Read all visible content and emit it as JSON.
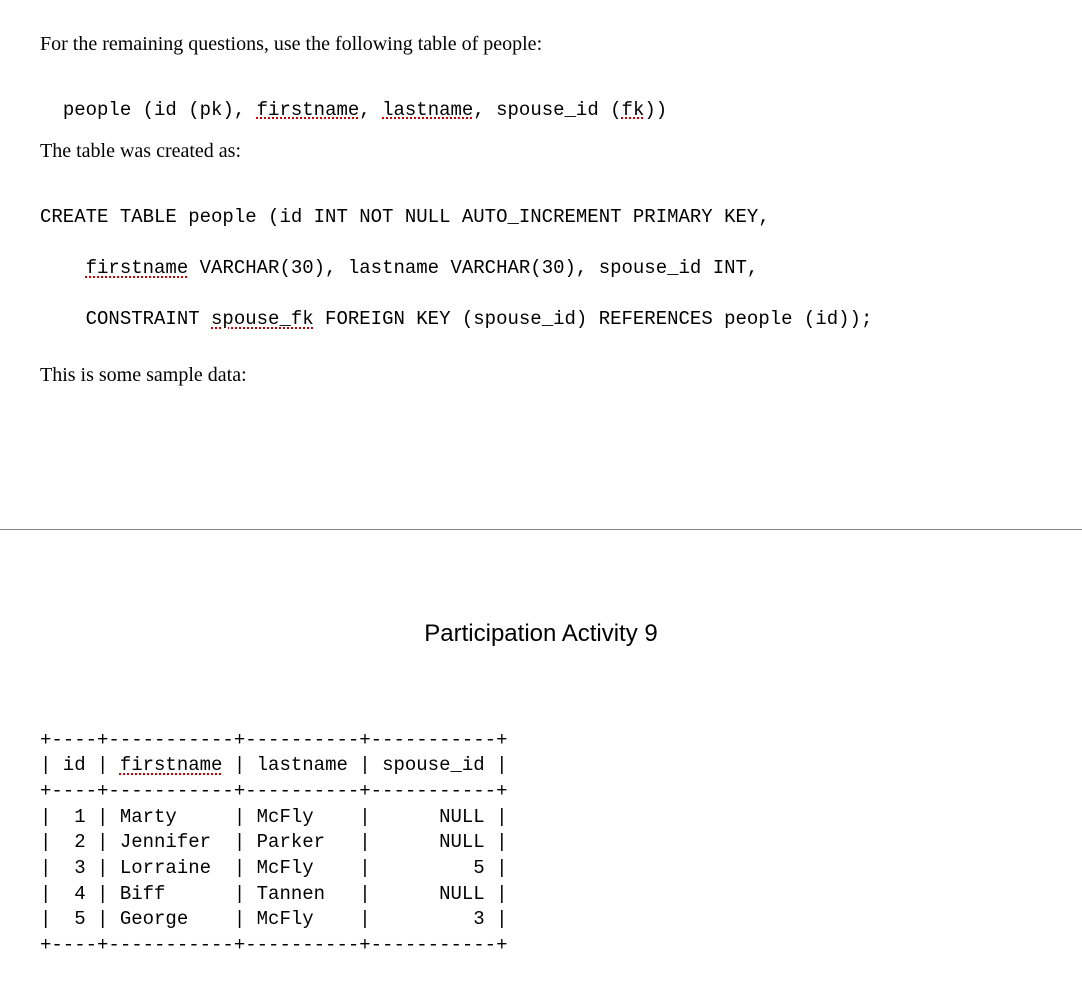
{
  "intro_text": "For the remaining questions, use the following table of people:",
  "schema_line": {
    "prefix": "people (id (pk), ",
    "fn": "firstname",
    "sep1": ", ",
    "ln": "lastname",
    "mid": ", spouse_id (",
    "fk": "fk",
    "suffix": "))"
  },
  "created_as": "The table was created as:",
  "create_sql": {
    "line1": "CREATE TABLE people (id INT NOT NULL AUTO_INCREMENT PRIMARY KEY,",
    "line2_indent": "    ",
    "line2_fn": "firstname",
    "line2_rest": " VARCHAR(30), lastname VARCHAR(30), spouse_id INT,",
    "line3_indent": "    CONSTRAINT ",
    "line3_sfk": "spouse_fk",
    "line3_rest": " FOREIGN KEY (spouse_id) REFERENCES people (id));"
  },
  "sample_data_text": "This is some sample data:",
  "activity_title": "Participation Activity 9",
  "table": {
    "border": "+----+-----------+----------+-----------+",
    "header_prefix": "| id | ",
    "header_fn": "firstname",
    "header_rest": " | lastname | spouse_id |",
    "rows": [
      "|  1 | Marty     | McFly    |      NULL |",
      "|  2 | Jennifer  | Parker   |      NULL |",
      "|  3 | Lorraine  | McFly    |         5 |",
      "|  4 | Biff      | Tannen   |      NULL |",
      "|  5 | George    | McFly    |         3 |"
    ]
  },
  "chart_data": {
    "type": "table",
    "columns": [
      "id",
      "firstname",
      "lastname",
      "spouse_id"
    ],
    "rows": [
      {
        "id": 1,
        "firstname": "Marty",
        "lastname": "McFly",
        "spouse_id": null
      },
      {
        "id": 2,
        "firstname": "Jennifer",
        "lastname": "Parker",
        "spouse_id": null
      },
      {
        "id": 3,
        "firstname": "Lorraine",
        "lastname": "McFly",
        "spouse_id": 5
      },
      {
        "id": 4,
        "firstname": "Biff",
        "lastname": "Tannen",
        "spouse_id": null
      },
      {
        "id": 5,
        "firstname": "George",
        "lastname": "McFly",
        "spouse_id": 3
      }
    ]
  }
}
